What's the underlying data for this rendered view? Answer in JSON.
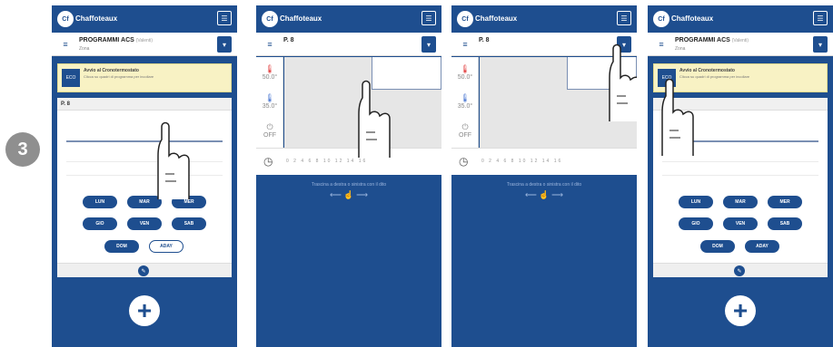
{
  "step_number": "3",
  "app": {
    "logo_letters": "Cf",
    "brand": "Chaffoteaux",
    "top_icon": "notebook-icon",
    "menu_icon_label": "☰"
  },
  "program": {
    "title": "PROGRAMMI ACS",
    "title_suffix": "(Valenti)",
    "subtitle": "Zona",
    "short_title": "P. 8"
  },
  "notice": {
    "box_label": "ECO",
    "title": "Avvio al Cronotermostato",
    "body": "Clicca su quadri di programma per incollare"
  },
  "card": {
    "header": "P. 8"
  },
  "days": {
    "row1": [
      "LUN",
      "MAR",
      "MER"
    ],
    "row2": [
      "GIO",
      "VEN",
      "SAB"
    ],
    "row3": [
      "DOM",
      "ADAY"
    ]
  },
  "temps": {
    "hot": "50.0°",
    "cold": "35.0°",
    "off": "OFF"
  },
  "timeline": "0   2   4   6   8  10  12  14  16",
  "swipe_hint": "Trascina a destra o sinistra con il dito",
  "plus_label": "+",
  "colors": {
    "brand_blue": "#1e4e8f",
    "notice_yellow": "#f8f2c4",
    "badge_grey": "#8f8f8f"
  }
}
